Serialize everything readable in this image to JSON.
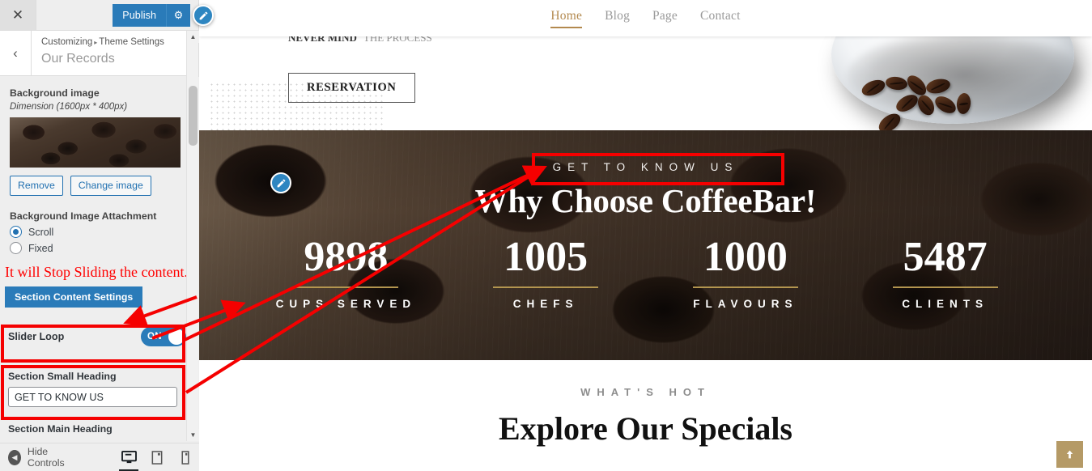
{
  "customizer": {
    "close_label": "✕",
    "publish_label": "Publish",
    "gear_label": "⚙",
    "back_label": "‹",
    "breadcrumb_root": "Customizing",
    "breadcrumb_sep": "▸",
    "breadcrumb_parent": "Theme Settings",
    "panel_title": "Our Records",
    "controls": {
      "bg_image_label": "Background image",
      "bg_image_dimension": "Dimension (1600px * 400px)",
      "remove_label": "Remove",
      "change_image_label": "Change image",
      "attachment_label": "Background Image Attachment",
      "attachment_options": [
        {
          "label": "Scroll",
          "selected": true
        },
        {
          "label": "Fixed",
          "selected": false
        }
      ],
      "section_content_settings_label": "Section Content Settings",
      "slider_loop_label": "Slider Loop",
      "slider_loop_state": "ON",
      "small_heading_label": "Section Small Heading",
      "small_heading_value": "GET TO KNOW US",
      "small_heading_placeholder": "Section Small Heading",
      "main_heading_label": "Section Main Heading"
    },
    "footer": {
      "hide_controls_label": "Hide Controls",
      "devices": [
        {
          "name": "desktop",
          "active": true
        },
        {
          "name": "tablet",
          "active": false
        },
        {
          "name": "mobile",
          "active": false
        }
      ]
    }
  },
  "annotations": {
    "note_text": "It will Stop Sliding the content.",
    "note_color": "#ff0000",
    "box_color": "#f50000"
  },
  "preview": {
    "nav": [
      {
        "label": "Home",
        "active": true
      },
      {
        "label": "Blog",
        "active": false
      },
      {
        "label": "Page",
        "active": false
      },
      {
        "label": "Contact",
        "active": false
      }
    ],
    "hero": {
      "reservation_label": "RESERVATION",
      "cut_text": "NEVER MIND",
      "cut_text_dim": "THE PROCESS"
    },
    "records": {
      "small_heading": "GET TO KNOW US",
      "main_heading": "Why Choose CoffeeBar!",
      "counters": [
        {
          "number": "9898",
          "label": "CUPS SERVED"
        },
        {
          "number": "1005",
          "label": "CHEFS"
        },
        {
          "number": "1000",
          "label": "FLAVOURS"
        },
        {
          "number": "5487",
          "label": "CLIENTS"
        }
      ]
    },
    "specials": {
      "small_heading": "WHAT'S HOT",
      "main_heading": "Explore Our Specials"
    },
    "back_to_top": "↑"
  },
  "colors": {
    "wp_blue": "#2a7bb9",
    "accent_gold": "#b3954f",
    "nav_active": "#b3894e",
    "annotation_red": "#ff0000"
  }
}
